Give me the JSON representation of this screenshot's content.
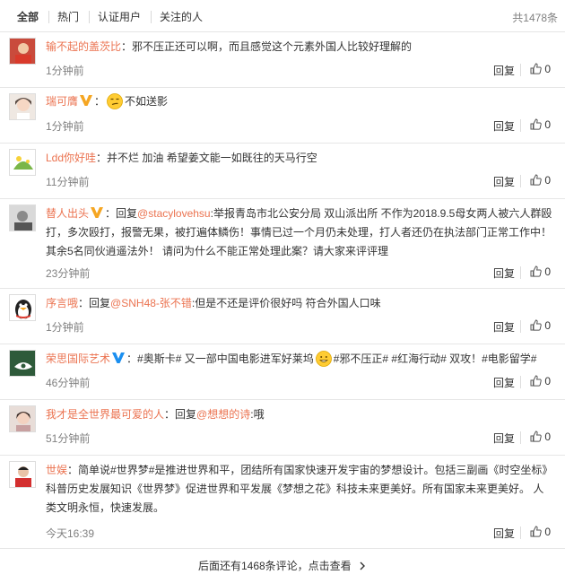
{
  "tabs": {
    "all": "全部",
    "hot": "热门",
    "verified": "认证用户",
    "following": "关注的人",
    "total": "共1478条"
  },
  "actions": {
    "reply": "回复"
  },
  "comments": [
    {
      "user": "输不起的盖茨比",
      "sep": "：",
      "text": "邪不压正还可以啊，而且感觉这个元素外国人比较好理解的",
      "time": "1分钟前",
      "likes": "0"
    },
    {
      "user": "瑞可膺",
      "sep": "：",
      "text": "不如送影",
      "time": "1分钟前",
      "likes": "0"
    },
    {
      "user": "Ldd你好哇",
      "sep": "：",
      "text": "并不烂 加油 希望姜文能一如既往的天马行空",
      "time": "11分钟前",
      "likes": "0"
    },
    {
      "user": "替人出头",
      "sep": "：",
      "reply_word": "回复",
      "mention": "@stacylovehsu",
      "text": ":举报青岛市北公安分局 双山派出所 不作为2018.9.5母女两人被六人群殴打，多次殴打，报警无果，被打遍体鳞伤！事情已过一个月仍未处理，打人者还仍在执法部门正常工作中！其余5名同伙逍遥法外！ 请问为什么不能正常处理此案？请大家来评评理",
      "time": "23分钟前",
      "likes": "0"
    },
    {
      "user": "序言哦",
      "sep": "：",
      "reply_word": "回复",
      "mention": "@SNH48-张不错",
      "text": ":但是不还是评价很好吗 符合外国人口味",
      "time": "1分钟前",
      "likes": "0"
    },
    {
      "user": "荣思国际艺术",
      "sep": "：",
      "text_a": "#奥斯卡# 又一部中国电影进军好莱坞",
      "text_b": "#邪不压正# #红海行动# 双攻！#电影留学#",
      "time": "46分钟前",
      "likes": "0"
    },
    {
      "user": "我才是全世界最可爱的人",
      "sep": "：",
      "reply_word": "回复",
      "mention": "@想想的诗",
      "text": ":哦",
      "time": "51分钟前",
      "likes": "0"
    },
    {
      "user": "世娱",
      "sep": "：",
      "text": "简单说#世界梦#是推进世界和平，团结所有国家快速开发宇宙的梦想设计。包括三副画《时空坐标》科普历史发展知识《世界梦》促进世界和平发展《梦想之花》科技未来更美好。所有国家未来更美好。 人类文明永恒，快速发展。",
      "time": "今天16:39",
      "likes": "0"
    }
  ],
  "more": "后面还有1468条评论，点击查看",
  "colors": {
    "accent": "#eb7350",
    "muted": "#808080",
    "verified_gold": "#f5a623",
    "verified_blue": "#1b8ff0",
    "divider": "#e6e6e6"
  }
}
